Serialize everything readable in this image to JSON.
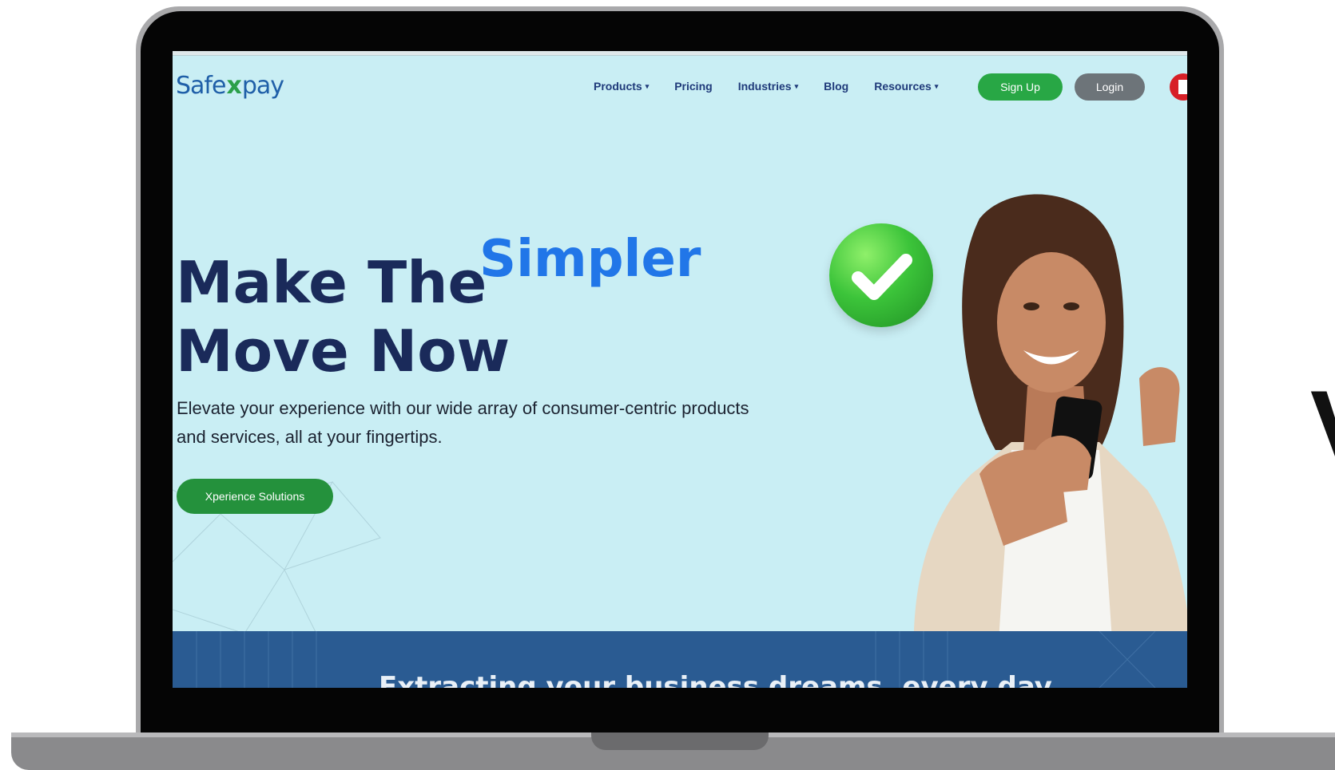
{
  "nav": {
    "logo": {
      "left": "Safe",
      "mark": "x",
      "right": "pay"
    },
    "items": [
      {
        "label": "Products",
        "has_dropdown": true
      },
      {
        "label": "Pricing",
        "has_dropdown": false
      },
      {
        "label": "Industries",
        "has_dropdown": true
      },
      {
        "label": "Blog",
        "has_dropdown": false
      },
      {
        "label": "Resources",
        "has_dropdown": true
      }
    ],
    "signup_label": "Sign Up",
    "login_label": "Login",
    "flag_icon": "uae-flag-icon"
  },
  "hero": {
    "title_line1": "Make The",
    "title_accent": "Simpler",
    "title_line2": "Move Now",
    "description": "Elevate your experience with our wide array of consumer-centric products and services, all at your fingertips.",
    "cta_label": "Xperience Solutions"
  },
  "band": {
    "text": "Extracting your business dreams, every day"
  },
  "colors": {
    "brand_blue": "#1f5fa8",
    "brand_green": "#28a745",
    "hero_bg": "#c9eef4",
    "heading": "#1a2a5a",
    "accent": "#2176e8",
    "band": "#2a5b92"
  }
}
